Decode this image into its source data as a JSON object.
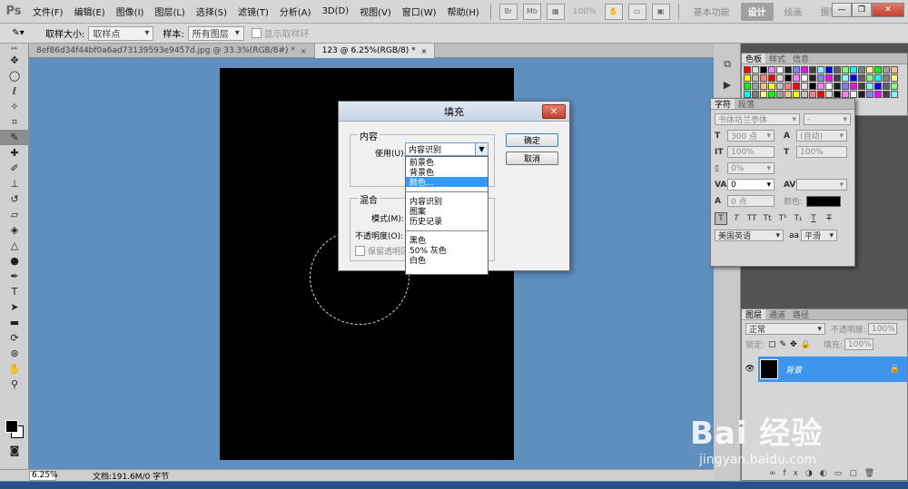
{
  "app": {
    "logo": "Ps",
    "menu": [
      "文件(F)",
      "编辑(E)",
      "图像(I)",
      "图层(L)",
      "选择(S)",
      "滤镜(T)",
      "分析(A)",
      "3D(D)",
      "视图(V)",
      "窗口(W)",
      "帮助(H)"
    ],
    "zoom": "100%",
    "workspaces": [
      "基本功能",
      "设计",
      "绘画",
      "摄影"
    ],
    "active_workspace": "设计",
    "window_minimize": "—",
    "window_restore": "❐",
    "window_close": "✕"
  },
  "options": {
    "sample_size_label": "取样大小:",
    "sample_size_value": "取样点",
    "sample_label": "样本:",
    "sample_value": "所有图层",
    "show_ring_label": "显示取样环"
  },
  "tabs": [
    {
      "label": "8ef86d34f44bf0a6ad73139593e9457d.jpg @ 33.3%(RGB/8#) *",
      "close": "×"
    },
    {
      "label": "123 @ 6.25%(RGB/8) *",
      "close": "×"
    }
  ],
  "status": {
    "zoom": "6.25%",
    "doc": "文档:191.6M/0 字节"
  },
  "panels": {
    "swatches_tabs": [
      "色板",
      "样式",
      "信息"
    ],
    "character_tabs": [
      "字符",
      "段落"
    ],
    "font_family": "书体坊兰亭体",
    "font_style": "-",
    "font_size": "300 点",
    "leading": "(自动)",
    "v_scale": "100%",
    "h_scale": "100%",
    "tracking_pct": "0%",
    "kerning": "0",
    "baseline": "0 点",
    "color_label": "颜色:",
    "language": "美国英语",
    "antialias_label": "aa",
    "antialias": "平滑",
    "layers_tabs": [
      "图层",
      "通道",
      "路径"
    ],
    "blend_mode": "正常",
    "opacity_label": "不透明度:",
    "opacity": "100%",
    "lock_label": "锁定:",
    "fill_label": "填充:",
    "fill": "100%",
    "layer_name": "背景"
  },
  "dialog": {
    "title": "填充",
    "close": "✕",
    "contents_label": "内容",
    "use_label": "使用(U):",
    "use_value": "内容识别",
    "ok": "确定",
    "cancel": "取消",
    "blending_label": "混合",
    "mode_label": "模式(M):",
    "opacity_label": "不透明度(O):",
    "preserve_label": "保留透明区"
  },
  "dropdown": {
    "group1": [
      "前景色",
      "背景色",
      "颜色..."
    ],
    "group2": [
      "内容识别",
      "图案",
      "历史记录"
    ],
    "group3": [
      "黑色",
      "50% 灰色",
      "白色"
    ],
    "highlighted": "颜色..."
  },
  "watermark": {
    "main": "Bai 经验",
    "sub": "jingyan.baidu.com"
  }
}
